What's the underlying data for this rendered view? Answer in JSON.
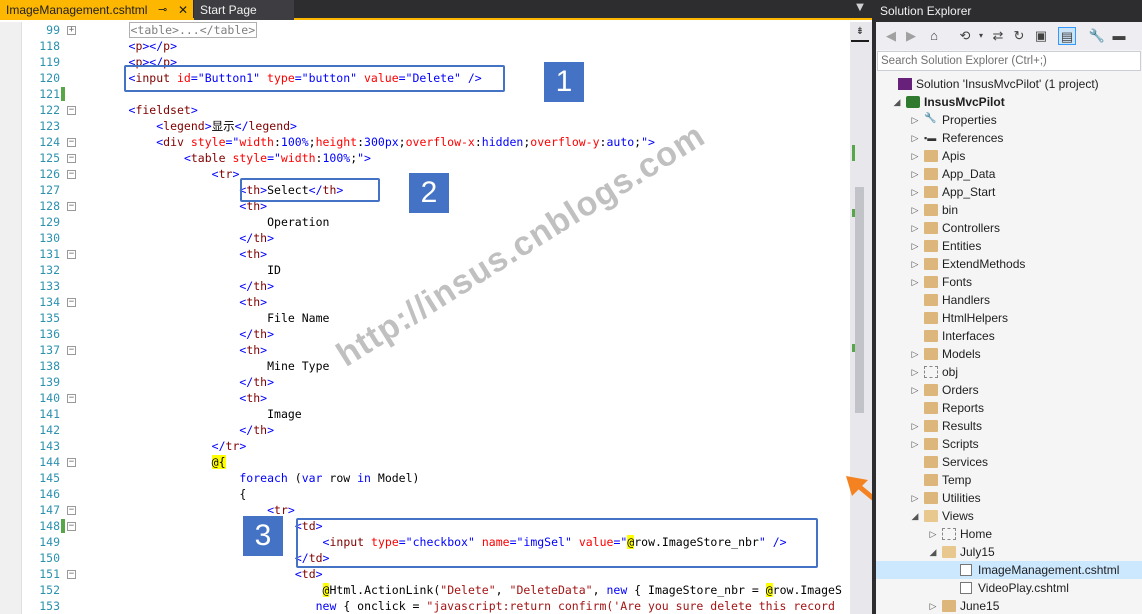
{
  "tabs": {
    "active": "ImageManagement.cshtml",
    "second": "Start Page",
    "pin_icon": "pin-icon",
    "close_icon": "close-icon"
  },
  "code_lines": [
    {
      "n": "99",
      "html": "<span class='collapsed'>&lt;table&gt;...&lt;/table&gt;</span>",
      "indent": 7
    },
    {
      "n": "118",
      "html": "<span class='v'>&lt;</span><span class='t'>p</span><span class='v'>&gt;&lt;/</span><span class='t'>p</span><span class='v'>&gt;</span>",
      "indent": 7
    },
    {
      "n": "119",
      "html": "<span class='v'>&lt;</span><span class='t'>p</span><span class='v'>&gt;&lt;/</span><span class='t'>p</span><span class='v'>&gt;</span>",
      "indent": 7
    },
    {
      "n": "120",
      "html": "<span class='v'>&lt;</span><span class='t'>input</span> <span class='a'>id</span><span class='v'>=\"Button1\"</span> <span class='a'>type</span><span class='v'>=\"button\"</span> <span class='a'>value</span><span class='v'>=\"Delete\"</span> <span class='v'>/&gt;</span>",
      "indent": 7
    },
    {
      "n": "121",
      "html": "",
      "indent": 0
    },
    {
      "n": "122",
      "html": "<span class='v'>&lt;</span><span class='t'>fieldset</span><span class='v'>&gt;</span>",
      "indent": 7
    },
    {
      "n": "123",
      "html": "<span class='v'>&lt;</span><span class='t'>legend</span><span class='v'>&gt;</span>显示<span class='v'>&lt;/</span><span class='t'>legend</span><span class='v'>&gt;</span>",
      "indent": 11
    },
    {
      "n": "124",
      "html": "<span class='v'>&lt;</span><span class='t'>div</span> <span class='a'>style</span><span class='v'>=\"</span><span class='a'>width</span>:<span class='v'>100%</span>;<span class='a'>height</span>:<span class='v'>300px</span>;<span class='a'>overflow-x</span>:<span class='v'>hidden</span>;<span class='a'>overflow-y</span>:<span class='v'>auto</span>;<span class='v'>\"&gt;</span>",
      "indent": 11
    },
    {
      "n": "125",
      "html": "<span class='v'>&lt;</span><span class='t'>table</span> <span class='a'>style</span><span class='v'>=\"</span><span class='a'>width</span>:<span class='v'>100%</span>;<span class='v'>\"&gt;</span>",
      "indent": 15
    },
    {
      "n": "126",
      "html": "<span class='v'>&lt;</span><span class='t'>tr</span><span class='v'>&gt;</span>",
      "indent": 19
    },
    {
      "n": "127",
      "html": "<span class='v'>&lt;</span><span class='t'>th</span><span class='v'>&gt;</span>Select<span class='v'>&lt;/</span><span class='t'>th</span><span class='v'>&gt;</span>",
      "indent": 23
    },
    {
      "n": "128",
      "html": "<span class='v'>&lt;</span><span class='t'>th</span><span class='v'>&gt;</span>",
      "indent": 23
    },
    {
      "n": "129",
      "html": "Operation",
      "indent": 27
    },
    {
      "n": "130",
      "html": "<span class='v'>&lt;/</span><span class='t'>th</span><span class='v'>&gt;</span>",
      "indent": 23
    },
    {
      "n": "131",
      "html": "<span class='v'>&lt;</span><span class='t'>th</span><span class='v'>&gt;</span>",
      "indent": 23
    },
    {
      "n": "132",
      "html": "ID",
      "indent": 27
    },
    {
      "n": "133",
      "html": "<span class='v'>&lt;/</span><span class='t'>th</span><span class='v'>&gt;</span>",
      "indent": 23
    },
    {
      "n": "134",
      "html": "<span class='v'>&lt;</span><span class='t'>th</span><span class='v'>&gt;</span>",
      "indent": 23
    },
    {
      "n": "135",
      "html": "File Name",
      "indent": 27
    },
    {
      "n": "136",
      "html": "<span class='v'>&lt;/</span><span class='t'>th</span><span class='v'>&gt;</span>",
      "indent": 23
    },
    {
      "n": "137",
      "html": "<span class='v'>&lt;</span><span class='t'>th</span><span class='v'>&gt;</span>",
      "indent": 23
    },
    {
      "n": "138",
      "html": "Mine Type",
      "indent": 27
    },
    {
      "n": "139",
      "html": "<span class='v'>&lt;/</span><span class='t'>th</span><span class='v'>&gt;</span>",
      "indent": 23
    },
    {
      "n": "140",
      "html": "<span class='v'>&lt;</span><span class='t'>th</span><span class='v'>&gt;</span>",
      "indent": 23
    },
    {
      "n": "141",
      "html": "Image",
      "indent": 27
    },
    {
      "n": "142",
      "html": "<span class='v'>&lt;/</span><span class='t'>th</span><span class='v'>&gt;</span>",
      "indent": 23
    },
    {
      "n": "143",
      "html": "<span class='v'>&lt;/</span><span class='t'>tr</span><span class='v'>&gt;</span>",
      "indent": 19
    },
    {
      "n": "144",
      "html": "<span class='hl'>@{</span>",
      "indent": 19
    },
    {
      "n": "145",
      "html": "<span class='k'>foreach</span> (<span class='k'>var</span> row <span class='k'>in</span> Model)",
      "indent": 23
    },
    {
      "n": "146",
      "html": "{",
      "indent": 23
    },
    {
      "n": "147",
      "html": "<span class='v'>&lt;</span><span class='t'>tr</span><span class='v'>&gt;</span>",
      "indent": 27
    },
    {
      "n": "148",
      "html": "<span class='v'>&lt;</span><span class='t'>td</span><span class='v'>&gt;</span>",
      "indent": 31
    },
    {
      "n": "149",
      "html": "<span class='v'>&lt;</span><span class='t'>input</span> <span class='a'>type</span><span class='v'>=\"checkbox\"</span> <span class='a'>name</span><span class='v'>=\"imgSel\"</span> <span class='a'>value</span><span class='v'>=\"</span><span class='hl'>@</span>row.ImageStore_nbr<span class='v'>\"</span> <span class='v'>/&gt;</span>",
      "indent": 35
    },
    {
      "n": "150",
      "html": "<span class='v'>&lt;/</span><span class='t'>td</span><span class='v'>&gt;</span>",
      "indent": 31
    },
    {
      "n": "151",
      "html": "<span class='v'>&lt;</span><span class='t'>td</span><span class='v'>&gt;</span>",
      "indent": 31
    },
    {
      "n": "152",
      "html": "<span class='hl'>@</span>Html.ActionLink(<span class='s'>\"Delete\"</span>, <span class='s'>\"DeleteData\"</span>, <span class='k'>new</span> { ImageStore_nbr = <span class='hl'>@</span>row.ImageS",
      "indent": 35
    },
    {
      "n": "153",
      "html": "<span class='k'>new</span> { onclick = <span class='s'>\"javascript:return confirm('Are you sure delete this record</span>",
      "indent": 34
    }
  ],
  "callouts": [
    "1",
    "2",
    "3"
  ],
  "watermark": "http://insus.cnblogs.com",
  "solution_explorer": {
    "title": "Solution Explorer",
    "search_placeholder": "Search Solution Explorer (Ctrl+;)",
    "toolbar_icons": [
      "back-icon",
      "forward-icon",
      "home-icon",
      "sync-pending-icon",
      "dropdown-icon",
      "sync-icon",
      "refresh-icon",
      "collapse-all-icon",
      "show-all-files-icon",
      "properties-icon",
      "preview-icon"
    ],
    "tree": [
      {
        "label": "Solution 'InsusMvcPilot' (1 project)",
        "type": "solution",
        "level": 0,
        "exp": ""
      },
      {
        "label": "InsusMvcPilot",
        "type": "project",
        "level": 0,
        "exp": "open",
        "bold": true
      },
      {
        "label": "Properties",
        "type": "wrench",
        "level": 1,
        "exp": "closed"
      },
      {
        "label": "References",
        "type": "refs",
        "level": 1,
        "exp": "closed"
      },
      {
        "label": "Apis",
        "type": "folder",
        "level": 1,
        "exp": "closed"
      },
      {
        "label": "App_Data",
        "type": "folder",
        "level": 1,
        "exp": "closed"
      },
      {
        "label": "App_Start",
        "type": "folder",
        "level": 1,
        "exp": "closed"
      },
      {
        "label": "bin",
        "type": "folder",
        "level": 1,
        "exp": "closed"
      },
      {
        "label": "Controllers",
        "type": "folder",
        "level": 1,
        "exp": "closed"
      },
      {
        "label": "Entities",
        "type": "folder",
        "level": 1,
        "exp": "closed"
      },
      {
        "label": "ExtendMethods",
        "type": "folder",
        "level": 1,
        "exp": "closed"
      },
      {
        "label": "Fonts",
        "type": "folder",
        "level": 1,
        "exp": "closed"
      },
      {
        "label": "Handlers",
        "type": "folder",
        "level": 1,
        "exp": ""
      },
      {
        "label": "HtmlHelpers",
        "type": "folder",
        "level": 1,
        "exp": ""
      },
      {
        "label": "Interfaces",
        "type": "folder",
        "level": 1,
        "exp": ""
      },
      {
        "label": "Models",
        "type": "folder",
        "level": 1,
        "exp": "closed"
      },
      {
        "label": "obj",
        "type": "dashfolder",
        "level": 1,
        "exp": "closed"
      },
      {
        "label": "Orders",
        "type": "folder",
        "level": 1,
        "exp": "closed"
      },
      {
        "label": "Reports",
        "type": "folder",
        "level": 1,
        "exp": ""
      },
      {
        "label": "Results",
        "type": "folder",
        "level": 1,
        "exp": "closed"
      },
      {
        "label": "Scripts",
        "type": "folder",
        "level": 1,
        "exp": "closed"
      },
      {
        "label": "Services",
        "type": "folder",
        "level": 1,
        "exp": ""
      },
      {
        "label": "Temp",
        "type": "folder",
        "level": 1,
        "exp": ""
      },
      {
        "label": "Utilities",
        "type": "folder",
        "level": 1,
        "exp": "closed"
      },
      {
        "label": "Views",
        "type": "folderopen",
        "level": 1,
        "exp": "open"
      },
      {
        "label": "Home",
        "type": "dashfolder",
        "level": 2,
        "exp": "closed"
      },
      {
        "label": "July15",
        "type": "folderopen",
        "level": 2,
        "exp": "open"
      },
      {
        "label": "ImageManagement.cshtml",
        "type": "file",
        "level": 3,
        "exp": "",
        "selected": true
      },
      {
        "label": "VideoPlay.cshtml",
        "type": "file",
        "level": 3,
        "exp": ""
      },
      {
        "label": "June15",
        "type": "folder",
        "level": 2,
        "exp": "closed"
      }
    ]
  },
  "colors": {
    "accent_tab": "#fdb700",
    "callout": "#4472c4",
    "arrow": "#f58220",
    "selection": "#cce8ff"
  }
}
